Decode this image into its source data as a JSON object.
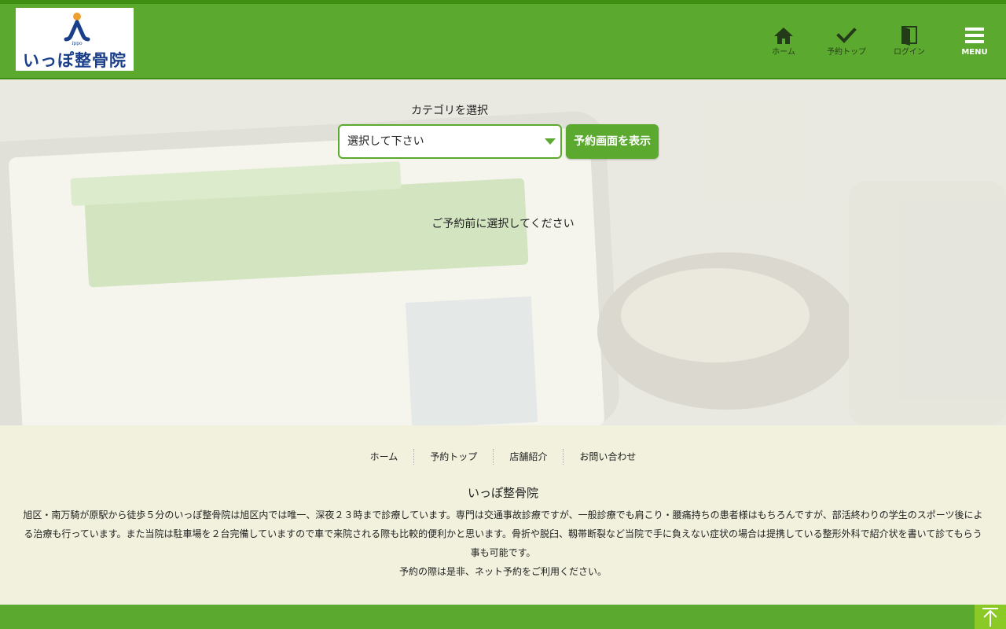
{
  "header": {
    "logo": {
      "text": "いっぽ整骨院",
      "mark_text": "ippo"
    },
    "nav": [
      {
        "label": "ホーム",
        "icon": "home-icon"
      },
      {
        "label": "予約トップ",
        "icon": "check-icon"
      },
      {
        "label": "ログイン",
        "icon": "door-icon"
      }
    ],
    "menu_label": "MENU"
  },
  "main": {
    "category_label": "カテゴリを選択",
    "select_value": "選択して下さい",
    "show_button": "予約画面を表示",
    "hint": "ご予約前に選択してください"
  },
  "footer": {
    "links": [
      "ホーム",
      "予約トップ",
      "店舗紹介",
      "お問い合わせ"
    ],
    "clinic_name": "いっぽ整骨院",
    "description": "旭区・南万騎が原駅から徒歩５分のいっぽ整骨院は旭区内では唯一、深夜２３時まで診療しています。専門は交通事故診療ですが、一般診療でも肩こり・腰痛持ちの患者様はもちろんですが、部活終わりの学生のスポーツ後による治療も行っています。また当院は駐車場を２台完備していますので車で来院される際も比較的便利かと思います。骨折や脱臼、靱帯断裂など当院で手に負えない症状の場合は提携している整形外科で紹介状を書いて診てもらう事も可能です。",
    "note": "予約の際は是非、ネット予約をご利用ください。"
  },
  "colors": {
    "brand_green": "#5ba92e",
    "dark_green": "#3e8f12",
    "footer_bg": "#f1f1de",
    "to_top_green": "#8ac926",
    "logo_blue": "#1a3f8a",
    "logo_orange": "#f0a030"
  }
}
